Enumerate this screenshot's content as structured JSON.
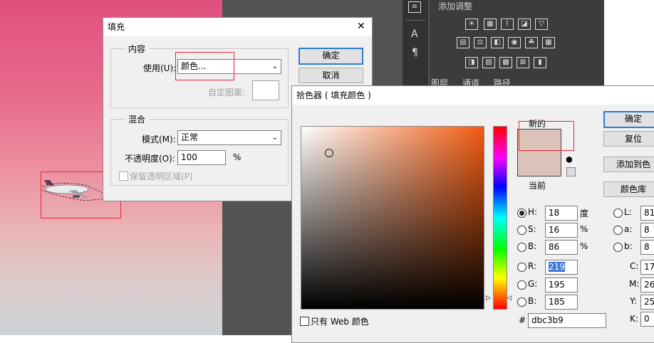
{
  "ps": {
    "panel_title": "添加调整",
    "tabs": [
      "图层",
      "通道",
      "路径"
    ]
  },
  "fill": {
    "title": "填充",
    "close": "✕",
    "content_group": "内容",
    "use_label": "使用(U):",
    "use_value": "颜色...",
    "pattern_label": "自定图案:",
    "blend_group": "混合",
    "mode_label": "模式(M):",
    "mode_value": "正常",
    "opacity_label": "不透明度(O):",
    "opacity_value": "100",
    "opacity_unit": "%",
    "preserve_label": "保留透明区域(P)",
    "ok": "确定",
    "cancel": "取消"
  },
  "picker": {
    "title": "拾色器 ( 填充颜色 )",
    "new_label": "新的",
    "current_label": "当前",
    "ok": "确定",
    "reset": "复位",
    "add_swatch": "添加到色",
    "libraries": "颜色库",
    "web_only": "只有 Web 颜色",
    "hash": "#",
    "hex": "dbc3b9",
    "hsb": [
      {
        "label": "H:",
        "value": "18",
        "unit": "度",
        "checked": true
      },
      {
        "label": "S:",
        "value": "16",
        "unit": "%",
        "checked": false
      },
      {
        "label": "B:",
        "value": "86",
        "unit": "%",
        "checked": false
      }
    ],
    "rgb": [
      {
        "label": "R:",
        "value": "219"
      },
      {
        "label": "G:",
        "value": "195"
      },
      {
        "label": "B:",
        "value": "185"
      }
    ],
    "lab": [
      {
        "label": "L:",
        "value": "81"
      },
      {
        "label": "a:",
        "value": "8"
      },
      {
        "label": "b:",
        "value": "8"
      }
    ],
    "cmyk": [
      {
        "label": "C:",
        "value": "17"
      },
      {
        "label": "M:",
        "value": "26"
      },
      {
        "label": "Y:",
        "value": "25"
      },
      {
        "label": "K:",
        "value": "0"
      }
    ],
    "hue_color": "#f25b12",
    "new_color": "#dbc3b9",
    "current_color": "#dbc3b9"
  }
}
